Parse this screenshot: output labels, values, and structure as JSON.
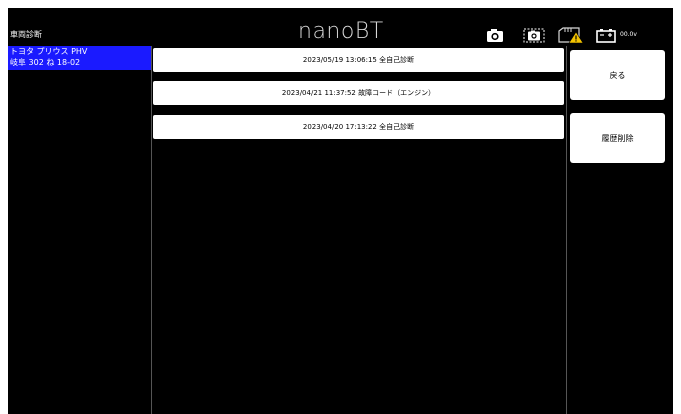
{
  "header": {
    "screen_title": "車両診断",
    "brand": "nanoBT",
    "voltage": "00.0v",
    "icons": [
      "camera-icon",
      "screenshot-icon",
      "sd-card-warning-icon",
      "battery-icon"
    ]
  },
  "sidebar": {
    "selected_vehicle": {
      "model": "トヨタ プリウス PHV",
      "plate": "岐阜 302 ね 18-02"
    }
  },
  "history": {
    "items": [
      {
        "label": "2023/05/19 13:06:15 全自己診断"
      },
      {
        "label": "2023/04/21 11:37:52 故障コード（エンジン）"
      },
      {
        "label": "2023/04/20 17:13:22 全自己診断"
      }
    ]
  },
  "actions": {
    "back_label": "戻る",
    "delete_history_label": "履歴削除"
  },
  "colors": {
    "background": "#000000",
    "selected": "#1a1aff",
    "button": "#ffffff",
    "warning": "#f2c200"
  }
}
